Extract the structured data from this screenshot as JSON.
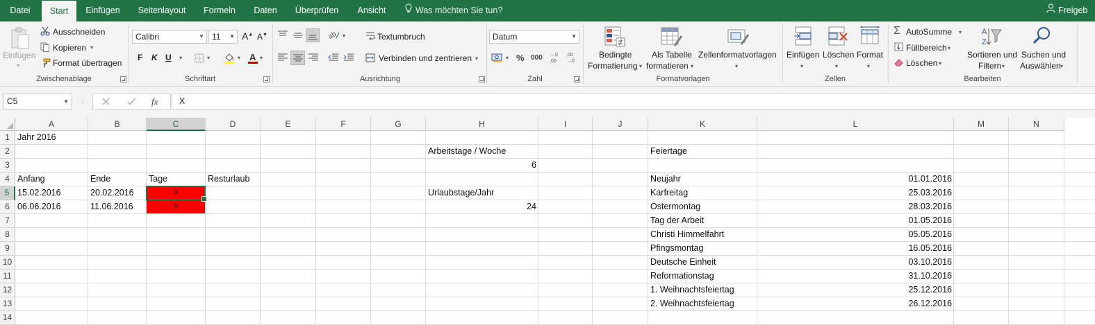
{
  "menu": {
    "tabs": [
      "Datei",
      "Start",
      "Einfügen",
      "Seitenlayout",
      "Formeln",
      "Daten",
      "Überprüfen",
      "Ansicht"
    ],
    "active": "Start",
    "tell_me": "Was möchten Sie tun?",
    "share": "Freigeb"
  },
  "ribbon": {
    "clipboard": {
      "paste": "Einfügen",
      "cut": "Ausschneiden",
      "copy": "Kopieren",
      "format_painter": "Format übertragen",
      "label": "Zwischenablage"
    },
    "font": {
      "name": "Calibri",
      "size": "11",
      "bold": "F",
      "italic": "K",
      "underline": "U",
      "label": "Schriftart"
    },
    "alignment": {
      "wrap": "Textumbruch",
      "merge": "Verbinden und zentrieren",
      "label": "Ausrichtung"
    },
    "number": {
      "format": "Datum",
      "percent": "%",
      "thousands": "000",
      "label": "Zahl"
    },
    "styles": {
      "conditional_1": "Bedingte",
      "conditional_2": "Formatierung",
      "table_1": "Als Tabelle",
      "table_2": "formatieren",
      "cell_styles": "Zellenformatvorlagen",
      "label": "Formatvorlagen"
    },
    "cells": {
      "insert": "Einfügen",
      "delete": "Löschen",
      "format": "Format",
      "label": "Zellen"
    },
    "editing": {
      "autosum": "AutoSumme",
      "fill": "Füllbereich",
      "clear": "Löschen",
      "sort_1": "Sortieren und",
      "sort_2": "Filtern",
      "find_1": "Suchen und",
      "find_2": "Auswählen",
      "label": "Bearbeiten"
    }
  },
  "formula_bar": {
    "name_box": "C5",
    "fx": "fx",
    "content": "X"
  },
  "sheet": {
    "columns": [
      "A",
      "B",
      "C",
      "D",
      "E",
      "F",
      "G",
      "H",
      "I",
      "J",
      "K",
      "L",
      "M",
      "N"
    ],
    "selected_column": "C",
    "rows": [
      "1",
      "2",
      "3",
      "4",
      "5",
      "6",
      "7",
      "8",
      "9",
      "10",
      "11",
      "12",
      "13",
      "14"
    ],
    "selected_row": "5",
    "active_cell": "C5",
    "fill_color": "#FF0000",
    "cells": {
      "A1": "Jahr 2016",
      "A4": "Anfang",
      "B4": "Ende",
      "C4": "Tage",
      "D4": "Resturlaub",
      "A5": "15.02.2016",
      "B5": "20.02.2016",
      "C5": "X",
      "A6": "06.06.2016",
      "B6": "11.06.2016",
      "C6": "X",
      "H2": "Arbeitstage / Woche",
      "H3": "6",
      "H5": "Urlaubstage/Jahr",
      "H6": "24",
      "K2": "Feiertage"
    },
    "holidays": [
      {
        "name": "Neujahr",
        "date": "01.01.2016"
      },
      {
        "name": "Karfreitag",
        "date": "25.03.2016"
      },
      {
        "name": "Ostermontag",
        "date": "28.03.2016"
      },
      {
        "name": "Tag der Arbeit",
        "date": "01.05.2016"
      },
      {
        "name": "Christi Himmelfahrt",
        "date": "05.05.2016"
      },
      {
        "name": "Pfingsmontag",
        "date": "16.05.2016"
      },
      {
        "name": "Deutsche Einheit",
        "date": "03.10.2016"
      },
      {
        "name": "Reformationstag",
        "date": "31.10.2016"
      },
      {
        "name": "1. Weihnachtsfeiertag",
        "date": "25.12.2016"
      },
      {
        "name": "2. Weihnachtsfeiertag",
        "date": "26.12.2016"
      }
    ]
  }
}
